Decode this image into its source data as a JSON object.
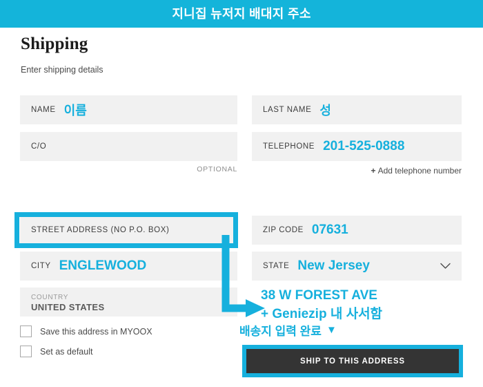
{
  "header": {
    "title": "지니집 뉴저지 배대지 주소",
    "background_color": "#14b4da"
  },
  "page": {
    "heading": "Shipping",
    "subheading": "Enter shipping details",
    "accent_color": "#16b0dd",
    "field_background": "#f1f1f1"
  },
  "form": {
    "left_column": {
      "name": {
        "label": "NAME",
        "value": "이름"
      },
      "co": {
        "label": "C/O",
        "value": "",
        "note": "OPTIONAL"
      },
      "street_address": {
        "label": "STREET ADDRESS (NO P.O. BOX)",
        "value": ""
      },
      "city": {
        "label": "CITY",
        "value": "ENGLEWOOD"
      },
      "country": {
        "label": "COUNTRY",
        "value": "UNITED STATES"
      }
    },
    "right_column": {
      "last_name": {
        "label": "LAST NAME",
        "value": "성"
      },
      "telephone": {
        "label": "TELEPHONE",
        "value": "201-525-0888",
        "add_link_plus": "+",
        "add_link_text": "Add telephone number"
      },
      "zip_code": {
        "label": "ZIP CODE",
        "value": "07631"
      },
      "state": {
        "label": "STATE",
        "value": "New Jersey",
        "chevron": "chevron-down-icon"
      }
    },
    "checkboxes": [
      {
        "label": "Save this address in MYOOX",
        "checked": false
      },
      {
        "label": "Set as default",
        "checked": false
      }
    ]
  },
  "annotations": {
    "address_line_1": "38 W FOREST AVE",
    "address_line_2": "+ Geniezip 내 사서함",
    "complete_text": "배송지 입력 완료",
    "complete_marker": "▼"
  },
  "submit": {
    "label": "SHIP TO THIS ADDRESS",
    "background_color": "#343434"
  }
}
